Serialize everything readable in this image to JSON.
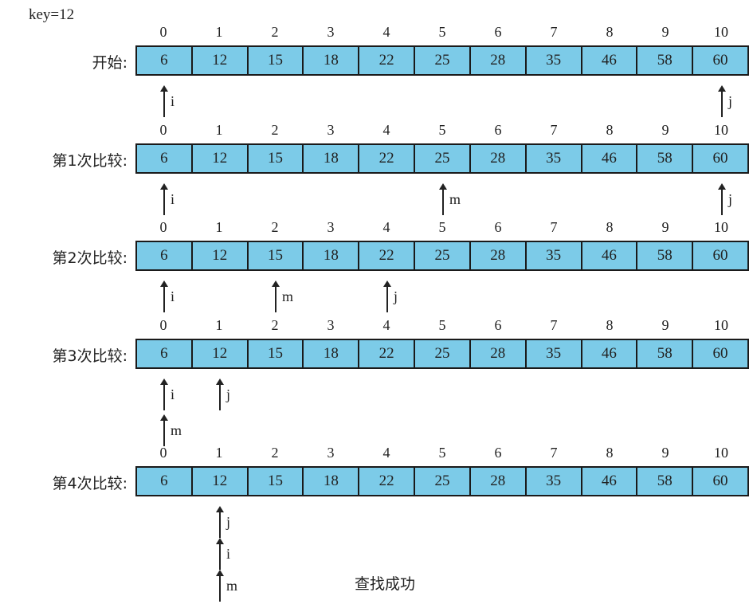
{
  "key_label": "key=12",
  "indices": [
    "0",
    "1",
    "2",
    "3",
    "4",
    "5",
    "6",
    "7",
    "8",
    "9",
    "10"
  ],
  "array": [
    "6",
    "12",
    "15",
    "18",
    "22",
    "25",
    "28",
    "35",
    "46",
    "58",
    "60"
  ],
  "rows": [
    {
      "label": "开始:",
      "pointers": [
        {
          "name": "i",
          "index": 0
        },
        {
          "name": "j",
          "index": 10
        }
      ]
    },
    {
      "label": "第1次比较:",
      "pointers": [
        {
          "name": "i",
          "index": 0
        },
        {
          "name": "m",
          "index": 5
        },
        {
          "name": "j",
          "index": 10
        }
      ]
    },
    {
      "label": "第2次比较:",
      "pointers": [
        {
          "name": "i",
          "index": 0
        },
        {
          "name": "m",
          "index": 2
        },
        {
          "name": "j",
          "index": 4
        }
      ]
    },
    {
      "label": "第3次比较:",
      "pointers": [
        {
          "name": "i",
          "index": 0
        },
        {
          "name": "j",
          "index": 1
        },
        {
          "name": "m",
          "index": 0
        }
      ]
    },
    {
      "label": "第4次比较:",
      "pointers": [
        {
          "name": "j",
          "index": 1
        },
        {
          "name": "i",
          "index": 1
        },
        {
          "name": "m",
          "index": 1
        }
      ]
    }
  ],
  "result": "查找成功"
}
